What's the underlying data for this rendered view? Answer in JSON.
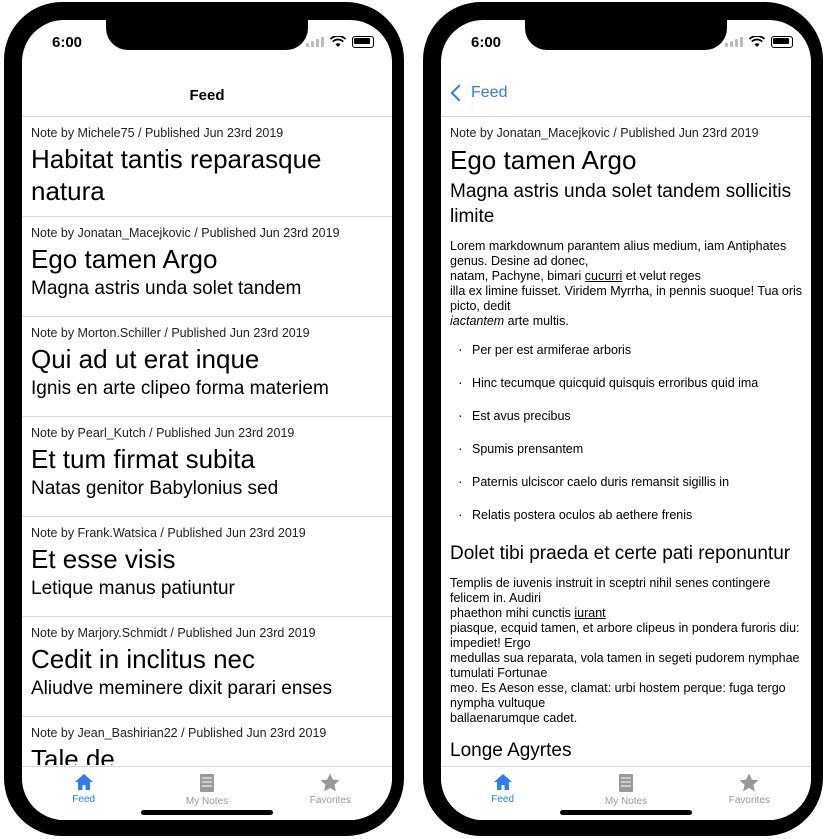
{
  "status": {
    "time": "6:00"
  },
  "feed": {
    "nav_title": "Feed",
    "items": [
      {
        "meta": "Note by Michele75 / Published Jun 23rd 2019",
        "title": "Habitat tantis reparasque natura",
        "sub": ""
      },
      {
        "meta": "Note by Jonatan_Macejkovic / Published Jun 23rd 2019",
        "title": "Ego tamen Argo",
        "sub": "Magna astris unda solet tandem"
      },
      {
        "meta": "Note by Morton.Schiller / Published Jun 23rd 2019",
        "title": "Qui ad ut erat inque",
        "sub": "Ignis en arte clipeo forma materiem"
      },
      {
        "meta": "Note by Pearl_Kutch / Published Jun 23rd 2019",
        "title": "Et tum firmat subita",
        "sub": "Natas genitor Babylonius sed"
      },
      {
        "meta": "Note by Frank.Watsica / Published Jun 23rd 2019",
        "title": "Et esse visis",
        "sub": "Letique manus patiuntur"
      },
      {
        "meta": "Note by Marjory.Schmidt / Published Jun 23rd 2019",
        "title": "Cedit in inclitus nec",
        "sub": "Aliudve meminere dixit parari enses"
      },
      {
        "meta": "Note by Jean_Bashirian22 / Published Jun 23rd 2019",
        "title": "Tale de",
        "sub": ""
      }
    ]
  },
  "detail": {
    "back_label": "Feed",
    "meta": "Note by Jonatan_Macejkovic / Published Jun 23rd 2019",
    "title": "Ego tamen Argo",
    "subtitle": "Magna astris unda solet tandem sollicitis limite",
    "p1_a": "Lorem markdownum parantem alius medium, iam Antiphates genus. Desine ad donec,",
    "p1_b": "natam, Pachyne, bimari ",
    "p1_link": "cucurri",
    "p1_c": " et velut reges",
    "p1_d": "illa ex limine fuisset. Viridem Myrrha, in pennis suoque! Tua oris picto, dedit",
    "p1_em": "iactantem",
    "p1_e": " arte multis.",
    "bullets": [
      "Per per est armiferae arboris",
      "Hinc tecumque quicquid quisquis erroribus quid ima",
      "Est avus precibus",
      "Spumis prensantem",
      "Paternis ulciscor caelo duris remansit sigillis in",
      "Relatis postera oculos ab aethere frenis"
    ],
    "h2": "Dolet tibi praeda et certe pati reponuntur",
    "p2_a": "Templis de iuvenis instruit in sceptri nihil senes contingere felicem in. Audiri",
    "p2_b": "phaethon mihi cunctis ",
    "p2_link": "iurant",
    "p2_c": "piasque, ecquid tamen, et arbore clipeus in pondera furoris diu: impediet! Ergo",
    "p2_d": "medullas sua reparata, vola tamen in segeti pudorem nymphae tumulati Fortunae",
    "p2_e": "meo. Es Aeson esse, clamat: urbi hostem perque: fuga tergo nympha vultuque",
    "p2_f": "ballaenarumque cadet.",
    "h3": "Longe Agyrtes"
  },
  "tabs": [
    {
      "label": "Feed",
      "icon": "home-icon"
    },
    {
      "label": "My Notes",
      "icon": "notes-icon"
    },
    {
      "label": "Favorites",
      "icon": "star-icon"
    }
  ],
  "colors": {
    "accent": "#2f7cf6",
    "inactive": "#999999"
  }
}
